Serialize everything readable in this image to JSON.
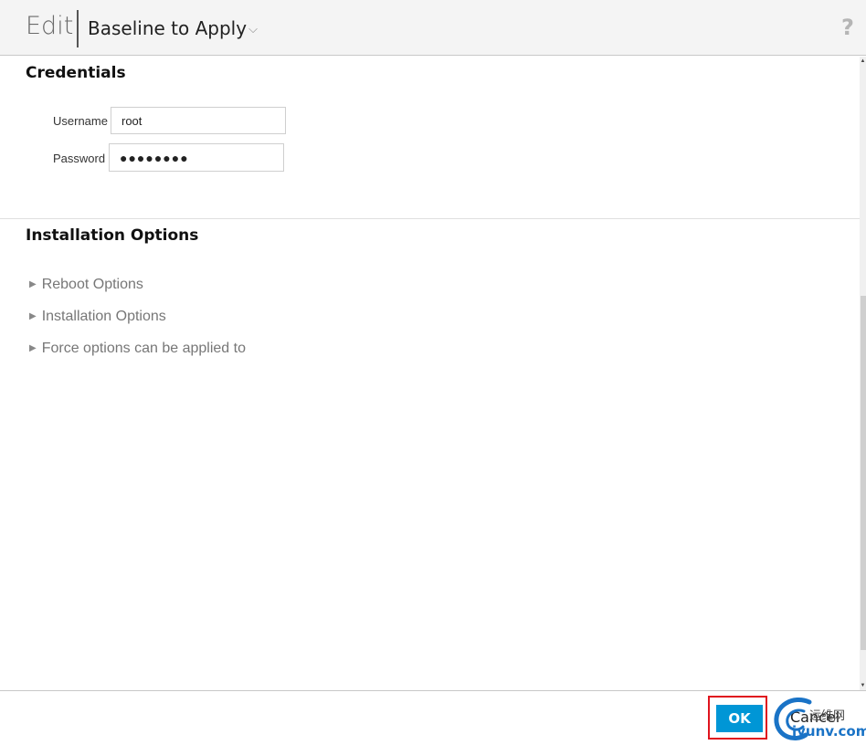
{
  "header": {
    "mode_label": "Edit",
    "view_selector_label": "Baseline to Apply",
    "help_label": "?"
  },
  "credentials": {
    "title": "Credentials",
    "username_label": "Username",
    "username_value": "root",
    "password_label": "Password",
    "password_value": "●●●●●●●●"
  },
  "installation": {
    "title": "Installation Options",
    "expanders": [
      {
        "label": "Reboot Options",
        "expanded": false
      },
      {
        "label": "Installation Options",
        "expanded": false
      },
      {
        "label": "Force options can be applied to",
        "expanded": false
      }
    ]
  },
  "footer": {
    "ok_label": "OK",
    "cancel_label": "Cancel"
  },
  "watermark": {
    "cn_text": "运维网",
    "domain_text": "iyunv.com"
  },
  "colors": {
    "primary_button": "#0096d6",
    "highlight_box": "#e0141e",
    "header_bg": "#f4f4f4"
  }
}
